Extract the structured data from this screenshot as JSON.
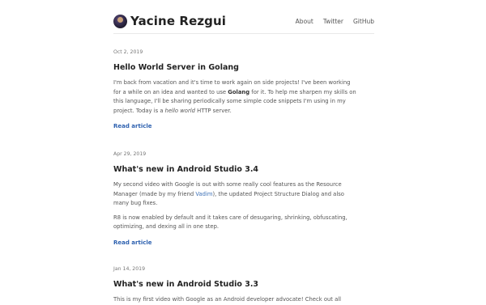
{
  "site": {
    "title": "Yacine Rezgui"
  },
  "nav": {
    "about": "About",
    "twitter": "Twitter",
    "github": "GitHub"
  },
  "posts": [
    {
      "date": "Oct 2, 2019",
      "title": "Hello World Server in Golang",
      "p1_a": "I'm back from vacation and it's time to work again on side projects! I've been working for a while on an idea and wanted to use ",
      "p1_bold": "Golang",
      "p1_b": " for it. To help me sharpen my skills on this language, I'll be sharing periodically some simple code snippets I'm using in my project. Today is a ",
      "p1_italic": "hello world",
      "p1_c": " HTTP server.",
      "read": "Read article"
    },
    {
      "date": "Apr 29, 2019",
      "title": "What's new in Android Studio 3.4",
      "p1_a": "My second video with Google is out with some really cool features as the Resource Manager (made by my friend ",
      "p1_link": "Vadim",
      "p1_b": "), the updated Project Structure Dialog and also many bug fixes.",
      "p2": "R8 is now enabled by default and it takes care of desugaring, shrinking, obfuscating, optimizing, and dexing all in one step.",
      "read": "Read article"
    },
    {
      "date": "Jan 14, 2019",
      "title": "What's new in Android Studio 3.3",
      "p1": "This is my first video with Google as an Android developer advocate! Check out all"
    }
  ]
}
